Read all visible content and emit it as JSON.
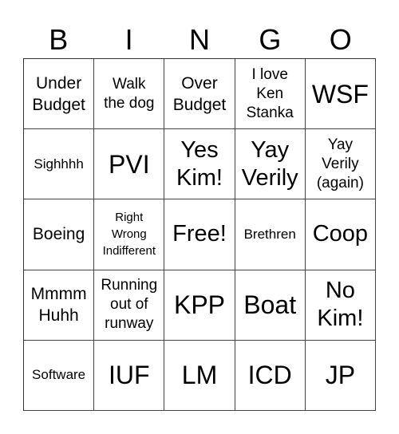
{
  "header": {
    "letters": [
      "B",
      "I",
      "N",
      "G",
      "O"
    ]
  },
  "grid": {
    "rows": [
      [
        {
          "text": "Under\nBudget",
          "size": "m"
        },
        {
          "text": "Walk\nthe dog",
          "size": "ms"
        },
        {
          "text": "Over\nBudget",
          "size": "m"
        },
        {
          "text": "I love\nKen\nStanka",
          "size": "ms"
        },
        {
          "text": "WSF",
          "size": "xl"
        }
      ],
      [
        {
          "text": "Sighhhh",
          "size": "s"
        },
        {
          "text": "PVI",
          "size": "xl"
        },
        {
          "text": "Yes\nKim!",
          "size": "l"
        },
        {
          "text": "Yay\nVerily",
          "size": "l"
        },
        {
          "text": "Yay\nVerily\n(again)",
          "size": "ms"
        }
      ],
      [
        {
          "text": "Boeing",
          "size": "m"
        },
        {
          "text": "Right\nWrong\nIndifferent",
          "size": "xs"
        },
        {
          "text": "Free!",
          "size": "l"
        },
        {
          "text": "Brethren",
          "size": "s"
        },
        {
          "text": "Coop",
          "size": "l"
        }
      ],
      [
        {
          "text": "Mmmm\nHuhh",
          "size": "m"
        },
        {
          "text": "Running\nout of\nrunway",
          "size": "ms"
        },
        {
          "text": "KPP",
          "size": "xl"
        },
        {
          "text": "Boat",
          "size": "xl"
        },
        {
          "text": "No\nKim!",
          "size": "l"
        }
      ],
      [
        {
          "text": "Software",
          "size": "s"
        },
        {
          "text": "IUF",
          "size": "xl"
        },
        {
          "text": "LM",
          "size": "xl"
        },
        {
          "text": "ICD",
          "size": "xl"
        },
        {
          "text": "JP",
          "size": "xl"
        }
      ]
    ]
  }
}
